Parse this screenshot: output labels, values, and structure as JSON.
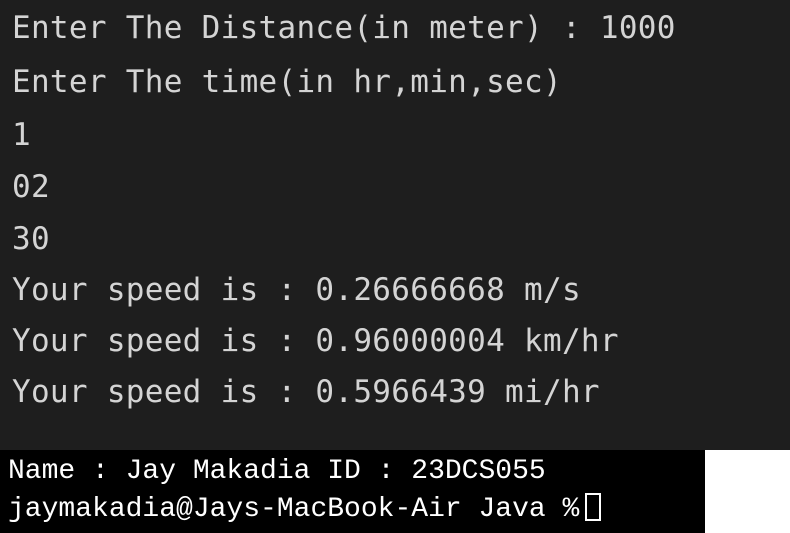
{
  "terminal": {
    "lines": [
      "Enter The Distance(in meter) : 1000",
      "Enter The time(in hr,min,sec)",
      "1",
      "02",
      "30",
      "Your speed is : 0.26666668 m/s",
      "Your speed is : 0.96000004 km/hr",
      "Your speed is : 0.5966439 mi/hr"
    ]
  },
  "footer": {
    "name_line": "Name : Jay Makadia ID : 23DCS055",
    "prompt": "jaymakadia@Jays-MacBook-Air Java %"
  },
  "colors": {
    "terminal_background": "#1e1e1e",
    "terminal_text": "#d4d4d4",
    "footer_background": "#000000",
    "footer_text": "#ffffff"
  }
}
